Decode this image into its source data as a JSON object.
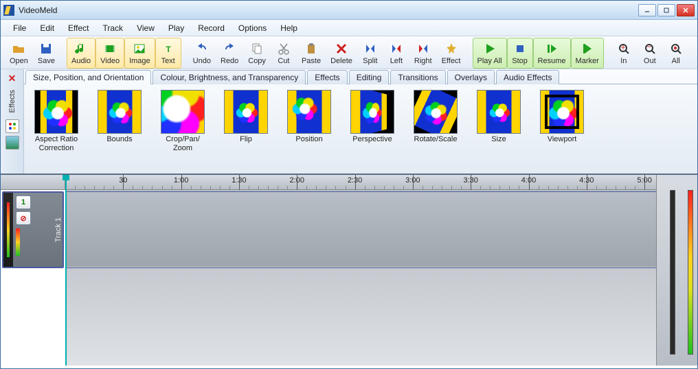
{
  "window": {
    "title": "VideoMeld"
  },
  "menu": [
    "File",
    "Edit",
    "Effect",
    "Track",
    "View",
    "Play",
    "Record",
    "Options",
    "Help"
  ],
  "toolbar": [
    {
      "id": "open",
      "label": "Open",
      "group": 0
    },
    {
      "id": "save",
      "label": "Save",
      "group": 0
    },
    {
      "id": "audio",
      "label": "Audio",
      "group": 1,
      "hl": "y"
    },
    {
      "id": "video",
      "label": "Video",
      "group": 1,
      "hl": "y"
    },
    {
      "id": "image",
      "label": "Image",
      "group": 1,
      "hl": "y"
    },
    {
      "id": "text",
      "label": "Text",
      "group": 1,
      "hl": "y"
    },
    {
      "id": "undo",
      "label": "Undo",
      "group": 2
    },
    {
      "id": "redo",
      "label": "Redo",
      "group": 2
    },
    {
      "id": "copy",
      "label": "Copy",
      "group": 2
    },
    {
      "id": "cut",
      "label": "Cut",
      "group": 2
    },
    {
      "id": "paste",
      "label": "Paste",
      "group": 2
    },
    {
      "id": "delete",
      "label": "Delete",
      "group": 2
    },
    {
      "id": "split",
      "label": "Split",
      "group": 2
    },
    {
      "id": "left",
      "label": "Left",
      "group": 2
    },
    {
      "id": "right",
      "label": "Right",
      "group": 2
    },
    {
      "id": "effect",
      "label": "Effect",
      "group": 2
    },
    {
      "id": "playall",
      "label": "Play All",
      "group": 3,
      "hl": "g"
    },
    {
      "id": "stop",
      "label": "Stop",
      "group": 3,
      "hl": "g"
    },
    {
      "id": "resume",
      "label": "Resume",
      "group": 3,
      "hl": "g"
    },
    {
      "id": "marker",
      "label": "Marker",
      "group": 3,
      "hl": "g"
    },
    {
      "id": "in",
      "label": "In",
      "group": 4
    },
    {
      "id": "out",
      "label": "Out",
      "group": 4
    },
    {
      "id": "all",
      "label": "All",
      "group": 4
    }
  ],
  "effects_panel": {
    "side_label": "Effects",
    "tabs": [
      "Size, Position, and Orientation",
      "Colour, Brightness, and Transparency",
      "Effects",
      "Editing",
      "Transitions",
      "Overlays",
      "Audio Effects"
    ],
    "active_tab": 0,
    "items": [
      {
        "label": "Aspect Ratio Correction"
      },
      {
        "label": "Bounds"
      },
      {
        "label": "Crop/Pan/ Zoom"
      },
      {
        "label": "Flip"
      },
      {
        "label": "Position"
      },
      {
        "label": "Perspective"
      },
      {
        "label": "Rotate/Scale"
      },
      {
        "label": "Size"
      },
      {
        "label": "Viewport"
      }
    ]
  },
  "timeline": {
    "ticks": [
      "30",
      "1:00",
      "1:30",
      "2:00",
      "2:30",
      "3:00",
      "3:30",
      "4:00",
      "4:30",
      "5:00"
    ],
    "track": {
      "number": "1",
      "label": "Track 1"
    }
  }
}
